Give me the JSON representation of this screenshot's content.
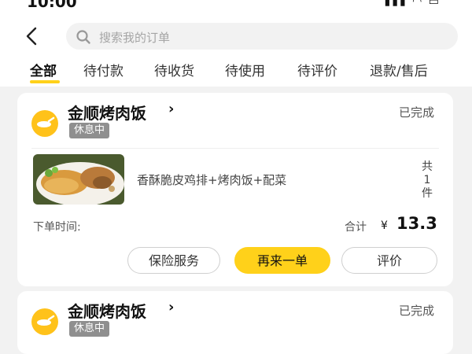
{
  "status_bar": {
    "time": "10:00",
    "icons": "signal wifi battery"
  },
  "search": {
    "placeholder": "搜索我的订单"
  },
  "tabs": [
    {
      "label": "全部",
      "active": true
    },
    {
      "label": "待付款",
      "active": false
    },
    {
      "label": "待收货",
      "active": false
    },
    {
      "label": "待使用",
      "active": false
    },
    {
      "label": "待评价",
      "active": false
    },
    {
      "label": "退款/售后",
      "active": false
    }
  ],
  "orders": [
    {
      "shop_name": "金顺烤肉饭",
      "shop_status": "休息中",
      "order_status": "已完成",
      "item_name": "香酥脆皮鸡排+烤肉饭+配菜",
      "count_prefix": "共",
      "count": "1",
      "count_suffix": "件",
      "order_time_label": "下单时间:",
      "total_label": "合计",
      "currency": "¥",
      "total": "13.3",
      "buttons": {
        "insurance": "保险服务",
        "reorder": "再来一单",
        "review": "评价"
      }
    },
    {
      "shop_name": "金顺烤肉饭",
      "shop_status": "休息中",
      "order_status": "已完成"
    }
  ],
  "colors": {
    "accent": "#ffd11a",
    "background": "#f2f2f2"
  }
}
